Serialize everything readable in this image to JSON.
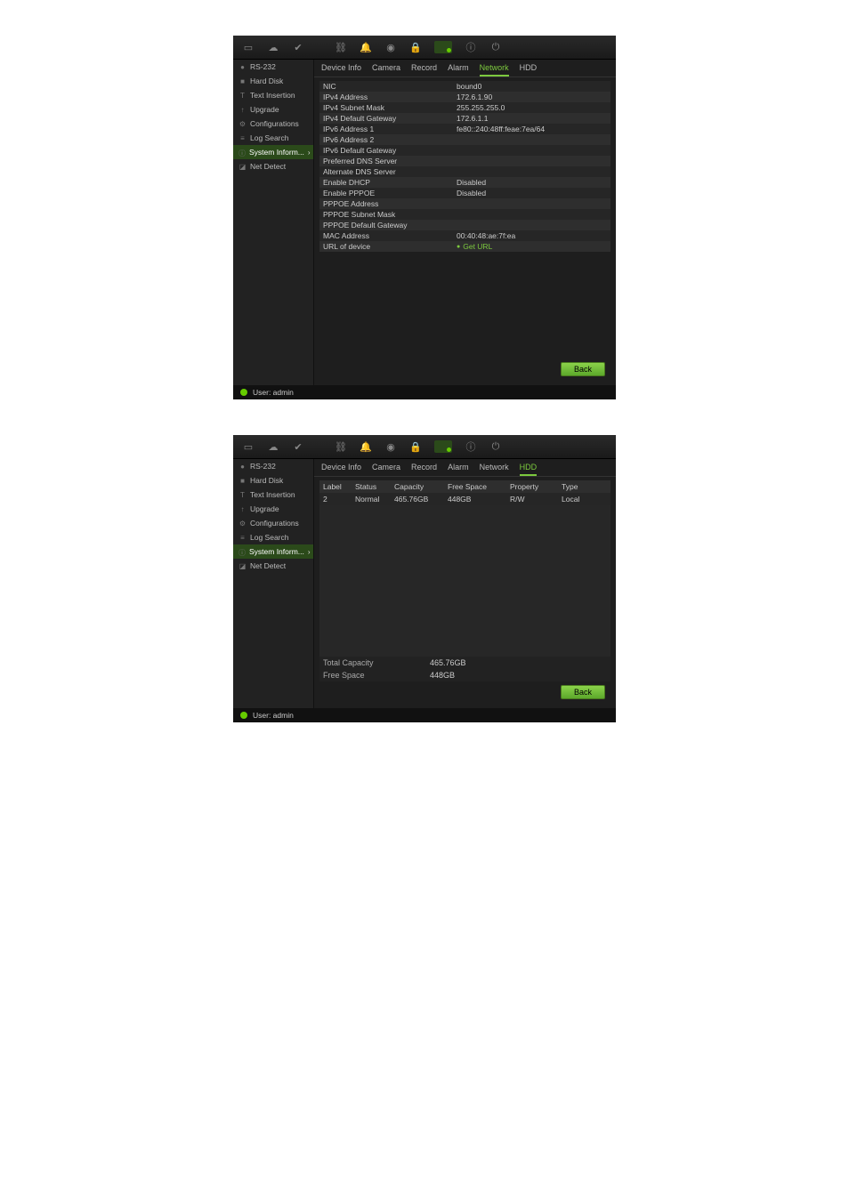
{
  "top_icons": [
    "monitor-icon",
    "cloud-icon",
    "check-circle-icon",
    "network-icon",
    "bell-icon",
    "record-icon",
    "lock-icon",
    "display-icon",
    "info-icon",
    "power-icon"
  ],
  "sidebar": {
    "items": [
      {
        "icon": "●",
        "label": "RS-232"
      },
      {
        "icon": "■",
        "label": "Hard Disk"
      },
      {
        "icon": "T",
        "label": "Text Insertion"
      },
      {
        "icon": "↑",
        "label": "Upgrade"
      },
      {
        "icon": "⚙",
        "label": "Configurations"
      },
      {
        "icon": "≡",
        "label": "Log Search"
      },
      {
        "icon": "ⓘ",
        "label": "System Inform..."
      },
      {
        "icon": "◪",
        "label": "Net Detect"
      }
    ],
    "selected_index": 6
  },
  "status_bar": {
    "user_label": "User: admin"
  },
  "shot1": {
    "tabs": [
      "Device Info",
      "Camera",
      "Record",
      "Alarm",
      "Network",
      "HDD"
    ],
    "active_tab_index": 4,
    "rows": [
      {
        "label": "NIC",
        "value": "bound0"
      },
      {
        "label": "IPv4 Address",
        "value": "172.6.1.90"
      },
      {
        "label": "IPv4 Subnet Mask",
        "value": "255.255.255.0"
      },
      {
        "label": "IPv4 Default Gateway",
        "value": "172.6.1.1"
      },
      {
        "label": "IPv6 Address 1",
        "value": "fe80::240:48ff:feae:7ea/64"
      },
      {
        "label": "IPv6 Address 2",
        "value": ""
      },
      {
        "label": "IPv6 Default Gateway",
        "value": ""
      },
      {
        "label": "Preferred DNS Server",
        "value": ""
      },
      {
        "label": "Alternate DNS Server",
        "value": ""
      },
      {
        "label": "Enable DHCP",
        "value": "Disabled"
      },
      {
        "label": "Enable PPPOE",
        "value": "Disabled"
      },
      {
        "label": "PPPOE Address",
        "value": ""
      },
      {
        "label": "PPPOE Subnet Mask",
        "value": ""
      },
      {
        "label": "PPPOE Default Gateway",
        "value": ""
      },
      {
        "label": "MAC Address",
        "value": "00:40:48:ae:7f:ea"
      },
      {
        "label": "URL of device",
        "value": "Get URL",
        "link": true
      }
    ],
    "back_label": "Back"
  },
  "shot2": {
    "tabs": [
      "Device Info",
      "Camera",
      "Record",
      "Alarm",
      "Network",
      "HDD"
    ],
    "active_tab_index": 5,
    "columns": {
      "label": "Label",
      "status": "Status",
      "capacity": "Capacity",
      "free": "Free Space",
      "property": "Property",
      "type": "Type"
    },
    "rows": [
      {
        "label": "2",
        "status": "Normal",
        "capacity": "465.76GB",
        "free": "448GB",
        "property": "R/W",
        "type": "Local"
      }
    ],
    "summary": [
      {
        "label": "Total Capacity",
        "value": "465.76GB"
      },
      {
        "label": "Free Space",
        "value": "448GB"
      }
    ],
    "back_label": "Back"
  }
}
